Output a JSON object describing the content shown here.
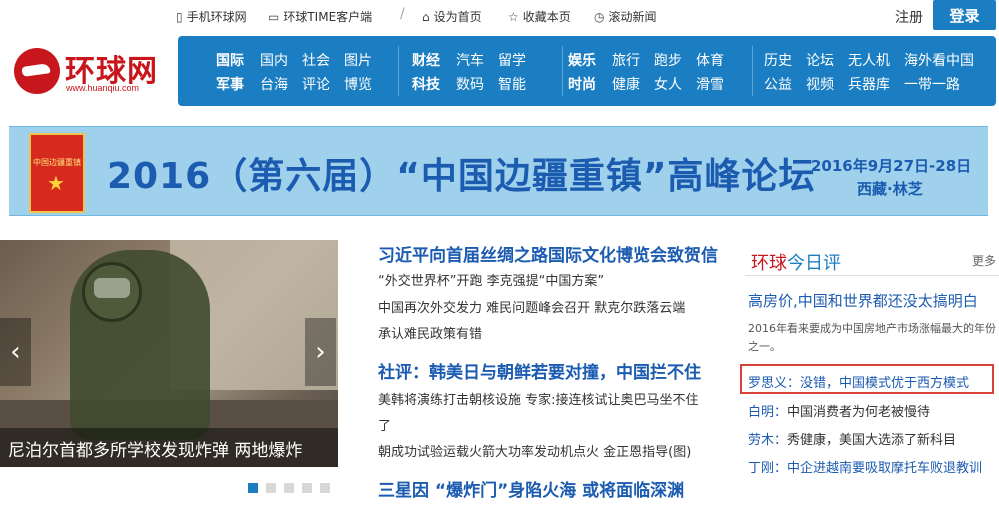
{
  "topbar": {
    "mobile": "手机环球网",
    "client": "环球TIME客户端",
    "homepage": "设为首页",
    "bookmark": "收藏本页",
    "scroll_news": "滚动新闻",
    "register": "注册",
    "login": "登录"
  },
  "logo": {
    "name": "环球网",
    "url": "www.huanqiu.com"
  },
  "nav": {
    "col1": [
      "国际",
      "国内",
      "社会",
      "图片",
      "军事",
      "台海",
      "评论",
      "博览"
    ],
    "col2": [
      "财经",
      "汽车",
      "留学",
      "科技",
      "数码",
      "智能"
    ],
    "col3": [
      "娱乐",
      "旅行",
      "跑步",
      "体育",
      "时尚",
      "健康",
      "女人",
      "滑雪"
    ],
    "col4": [
      "历史",
      "论坛",
      "无人机",
      "海外看中国",
      "公益",
      "视频",
      "兵器库",
      "一带一路"
    ]
  },
  "banner": {
    "title": "2016（第六届）“中国边疆重镇”高峰论坛",
    "date": "2016年9月27日-28日",
    "location": "西藏·林芝",
    "emblem": "中国边疆重镇"
  },
  "slideshow": {
    "caption": "尼泊尔首都多所学校发现炸弹 两地爆炸",
    "prev": "‹",
    "next": "›"
  },
  "news": {
    "h1": "习近平向首届丝绸之路国际文化博览会致贺信",
    "l1": "“外交世界杯”开跑 李克强提“中国方案”",
    "l2": "中国再次外交发力 难民问题峰会召开 默克尔跌落云端",
    "l3": "承认难民政策有错",
    "h2": "社评：韩美日与朝鲜若要对撞，中国拦不住",
    "l4": "美韩将演练打击朝核设施 专家:接连核试让奥巴马坐不住",
    "l5": "了",
    "l6": "朝成功试验运载火箭大功率发动机点火 金正恩指导(图)",
    "h3": "三星因 “爆炸门”身陷火海 或将面临深渊"
  },
  "commentary": {
    "title_a": "环球",
    "title_b": "今日评",
    "more": "更多",
    "headline": "高房价,中国和世界都还没太搞明白",
    "desc": "2016年看来要成为中国房地产市场涨幅最大的年份之一。",
    "items": [
      {
        "name": "罗思义：",
        "text": "没错，中国模式优于西方模式"
      },
      {
        "name": "白明：",
        "text": "中国消费者为何老被慢待"
      },
      {
        "name": "劳木：",
        "text": "秀健康，美国大选添了新科目"
      },
      {
        "name": "丁刚：",
        "text": "中企进越南要吸取摩托车败退教训"
      }
    ]
  },
  "colors": {
    "brand_red": "#c8161d",
    "nav_blue": "#1b7ec2",
    "headline_blue": "#1b5bb0",
    "highlight_box": "#d9403b"
  }
}
